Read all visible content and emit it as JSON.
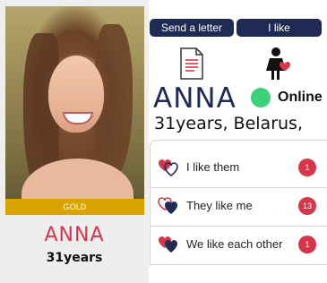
{
  "profile": {
    "badge": "GOLD",
    "name": "ANNA",
    "age": "31years",
    "big_name": "ANNA",
    "status": "Online",
    "age_location": "31years, Belarus,"
  },
  "actions": {
    "send_letter": "Send a letter",
    "i_like": "I like"
  },
  "likes": [
    {
      "label": "I like them",
      "count": "1"
    },
    {
      "label": "They like me",
      "count": "13"
    },
    {
      "label": "We like each other",
      "count": "1"
    }
  ],
  "colors": {
    "navy": "#1f2b55",
    "accent_red": "#d8354d",
    "gold": "#d9a300",
    "online_green": "#3bd07a"
  },
  "icons": [
    "letter-icon",
    "person-heart-icon",
    "heart-pair-icon"
  ]
}
